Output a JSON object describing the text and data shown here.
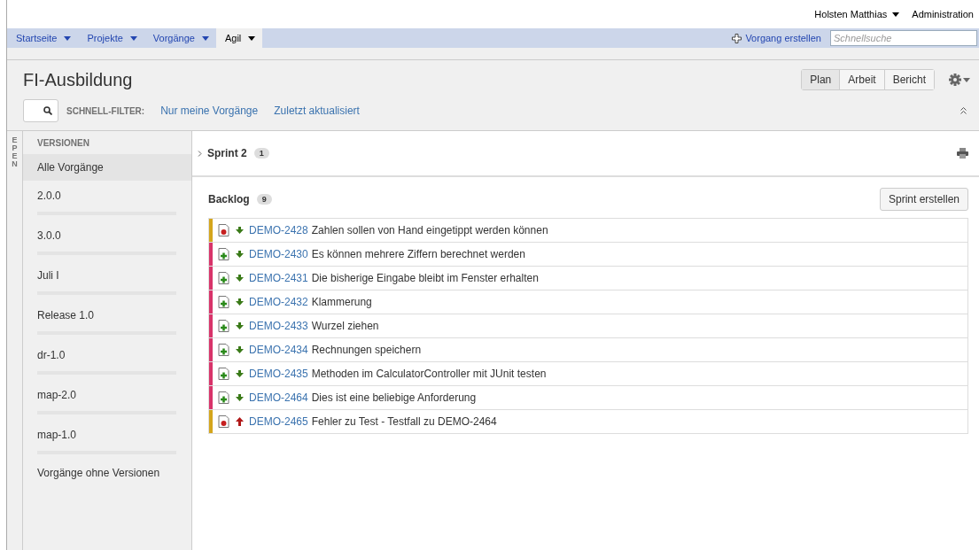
{
  "user_menu": {
    "user": "Holsten Matthias",
    "admin": "Administration"
  },
  "nav": [
    {
      "label": "Startseite",
      "selected": false
    },
    {
      "label": "Projekte",
      "selected": false
    },
    {
      "label": "Vorgänge",
      "selected": false
    },
    {
      "label": "Agil",
      "selected": true
    }
  ],
  "create_link": "Vorgang erstellen",
  "quick_search": {
    "placeholder": "Schnellsuche"
  },
  "board": {
    "title": "FI-Ausbildung",
    "views": [
      {
        "label": "Plan",
        "selected": true
      },
      {
        "label": "Arbeit",
        "selected": false
      },
      {
        "label": "Bericht",
        "selected": false
      }
    ]
  },
  "quick_filters": {
    "label": "SCHNELL-FILTER:",
    "filters": [
      "Nur meine Vorgänge",
      "Zuletzt aktualisiert"
    ]
  },
  "epics_tab": "EPEN",
  "versions": {
    "heading": "VERSIONEN",
    "items": [
      {
        "label": "Alle Vorgänge",
        "selected": true,
        "kind": "plain"
      },
      {
        "label": "2.0.0",
        "selected": false,
        "kind": "version"
      },
      {
        "label": "3.0.0",
        "selected": false,
        "kind": "version"
      },
      {
        "label": "Juli I",
        "selected": false,
        "kind": "version"
      },
      {
        "label": "Release 1.0",
        "selected": false,
        "kind": "version"
      },
      {
        "label": "dr-1.0",
        "selected": false,
        "kind": "version"
      },
      {
        "label": "map-2.0",
        "selected": false,
        "kind": "version"
      },
      {
        "label": "map-1.0",
        "selected": false,
        "kind": "version"
      },
      {
        "label": "Vorgänge ohne Versionen",
        "selected": false,
        "kind": "plain"
      }
    ]
  },
  "sprint": {
    "name": "Sprint 2",
    "count": "1",
    "expanded": false
  },
  "backlog": {
    "name": "Backlog",
    "count": "9",
    "create_button": "Sprint erstellen",
    "issues": [
      {
        "key": "DEMO-2428",
        "summary": "Zahlen sollen von Hand eingetippt werden können",
        "type_icon": {
          "kind": "bug"
        },
        "priority_icon": {
          "kind": "low"
        },
        "color": "#d4a51c"
      },
      {
        "key": "DEMO-2430",
        "summary": "Es können mehrere Ziffern berechnet werden",
        "type_icon": {
          "kind": "story"
        },
        "priority_icon": {
          "kind": "low"
        },
        "color": "#d8336a"
      },
      {
        "key": "DEMO-2431",
        "summary": "Die bisherige Eingabe bleibt im Fenster erhalten",
        "type_icon": {
          "kind": "story"
        },
        "priority_icon": {
          "kind": "low"
        },
        "color": "#d8336a"
      },
      {
        "key": "DEMO-2432",
        "summary": "Klammerung",
        "type_icon": {
          "kind": "story"
        },
        "priority_icon": {
          "kind": "low"
        },
        "color": "#d8336a"
      },
      {
        "key": "DEMO-2433",
        "summary": "Wurzel ziehen",
        "type_icon": {
          "kind": "story"
        },
        "priority_icon": {
          "kind": "low"
        },
        "color": "#d8336a"
      },
      {
        "key": "DEMO-2434",
        "summary": "Rechnungen speichern",
        "type_icon": {
          "kind": "story"
        },
        "priority_icon": {
          "kind": "low"
        },
        "color": "#d8336a"
      },
      {
        "key": "DEMO-2435",
        "summary": "Methoden im CalculatorController mit JUnit testen",
        "type_icon": {
          "kind": "story"
        },
        "priority_icon": {
          "kind": "low"
        },
        "color": "#d8336a"
      },
      {
        "key": "DEMO-2464",
        "summary": "Dies ist eine beliebige Anforderung",
        "type_icon": {
          "kind": "story"
        },
        "priority_icon": {
          "kind": "low"
        },
        "color": "#d8336a"
      },
      {
        "key": "DEMO-2465",
        "summary": "Fehler zu Test - Testfall zu DEMO-2464",
        "type_icon": {
          "kind": "bug"
        },
        "priority_icon": {
          "kind": "high"
        },
        "color": "#d4a51c"
      }
    ]
  }
}
